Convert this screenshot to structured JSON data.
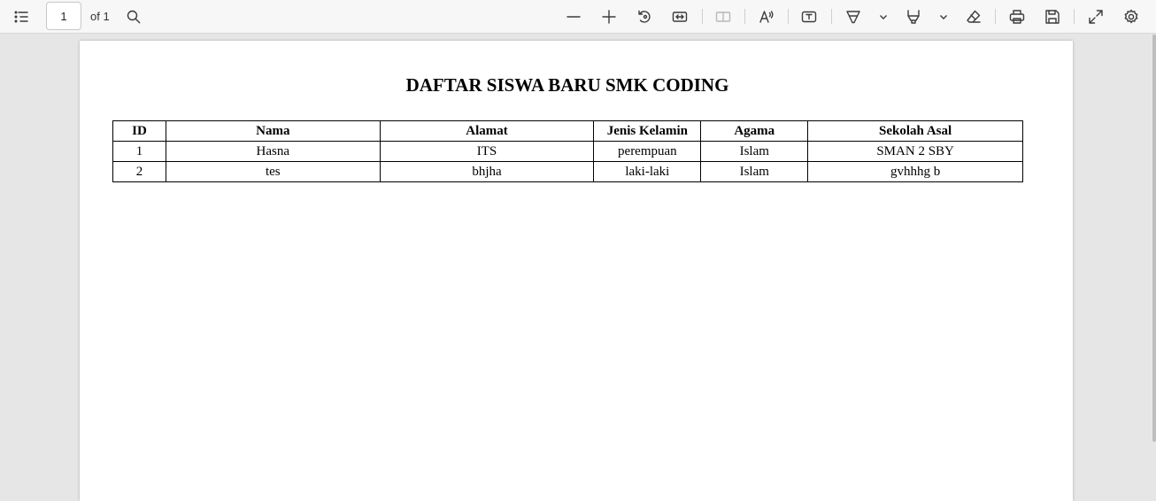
{
  "toolbar": {
    "page_current": "1",
    "page_total_label": "of 1",
    "icons": [
      "contents-icon",
      "search-icon",
      "zoom-out-icon",
      "zoom-in-icon",
      "rotate-icon",
      "fit-width-icon",
      "page-view-icon",
      "read-aloud-icon",
      "text-box-icon",
      "draw-icon",
      "chevron-down-icon",
      "highlight-icon",
      "chevron-down-icon",
      "eraser-icon",
      "print-icon",
      "save-icon",
      "fullscreen-icon",
      "settings-icon"
    ]
  },
  "document": {
    "title": "DAFTAR SISWA BARU SMK CODING",
    "table": {
      "headers": [
        "ID",
        "Nama",
        "Alamat",
        "Jenis Kelamin",
        "Agama",
        "Sekolah Asal"
      ],
      "rows": [
        [
          "1",
          "Hasna",
          "ITS",
          "perempuan",
          "Islam",
          "SMAN 2 SBY"
        ],
        [
          "2",
          "tes",
          "bhjha",
          "laki-laki",
          "Islam",
          "gvhhhg b"
        ]
      ]
    }
  }
}
